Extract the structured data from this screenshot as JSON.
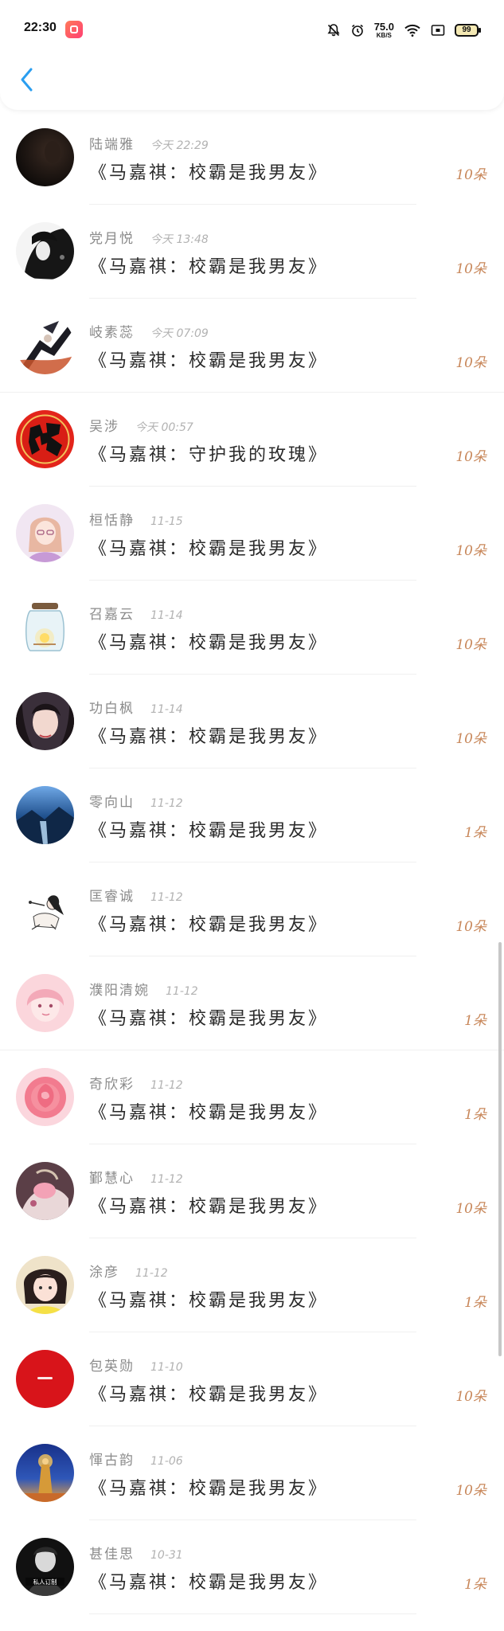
{
  "status_bar": {
    "time": "22:30",
    "net_speed_value": "75.0",
    "net_speed_unit": "KB/S",
    "battery": "99"
  },
  "header": {
    "back_icon": "chevron-left-icon",
    "accent_color": "#2a9ef0"
  },
  "records": [
    {
      "name": "陆端雅",
      "time": "今天 22:29",
      "title": "《马嘉祺：校霸是我男友》",
      "gift": "10朵"
    },
    {
      "name": "党月悦",
      "time": "今天 13:48",
      "title": "《马嘉祺：校霸是我男友》",
      "gift": "10朵"
    },
    {
      "name": "岐素蕊",
      "time": "今天 07:09",
      "title": "《马嘉祺：校霸是我男友》",
      "gift": "10朵"
    },
    {
      "name": "吴涉",
      "time": "今天 00:57",
      "title": "《马嘉祺：守护我的玫瑰》",
      "gift": "10朵"
    },
    {
      "name": "桓恬静",
      "time": "11-15",
      "title": "《马嘉祺：校霸是我男友》",
      "gift": "10朵"
    },
    {
      "name": "召嘉云",
      "time": "11-14",
      "title": "《马嘉祺：校霸是我男友》",
      "gift": "10朵"
    },
    {
      "name": "功白枫",
      "time": "11-14",
      "title": "《马嘉祺：校霸是我男友》",
      "gift": "10朵"
    },
    {
      "name": "零向山",
      "time": "11-12",
      "title": "《马嘉祺：校霸是我男友》",
      "gift": "1朵"
    },
    {
      "name": "匡睿诚",
      "time": "11-12",
      "title": "《马嘉祺：校霸是我男友》",
      "gift": "10朵"
    },
    {
      "name": "濮阳清婉",
      "time": "11-12",
      "title": "《马嘉祺：校霸是我男友》",
      "gift": "1朵"
    },
    {
      "name": "奇欣彩",
      "time": "11-12",
      "title": "《马嘉祺：校霸是我男友》",
      "gift": "1朵"
    },
    {
      "name": "鄞慧心",
      "time": "11-12",
      "title": "《马嘉祺：校霸是我男友》",
      "gift": "10朵"
    },
    {
      "name": "涂彦",
      "time": "11-12",
      "title": "《马嘉祺：校霸是我男友》",
      "gift": "1朵"
    },
    {
      "name": "包英勋",
      "time": "11-10",
      "title": "《马嘉祺：校霸是我男友》",
      "gift": "10朵"
    },
    {
      "name": "惲古韵",
      "time": "11-06",
      "title": "《马嘉祺：校霸是我男友》",
      "gift": "10朵"
    },
    {
      "name": "甚佳思",
      "time": "10-31",
      "title": "《马嘉祺：校霸是我男友》",
      "gift": "1朵"
    }
  ],
  "avatar_badge_text": "私人订制",
  "gift_color": "#c8875a"
}
